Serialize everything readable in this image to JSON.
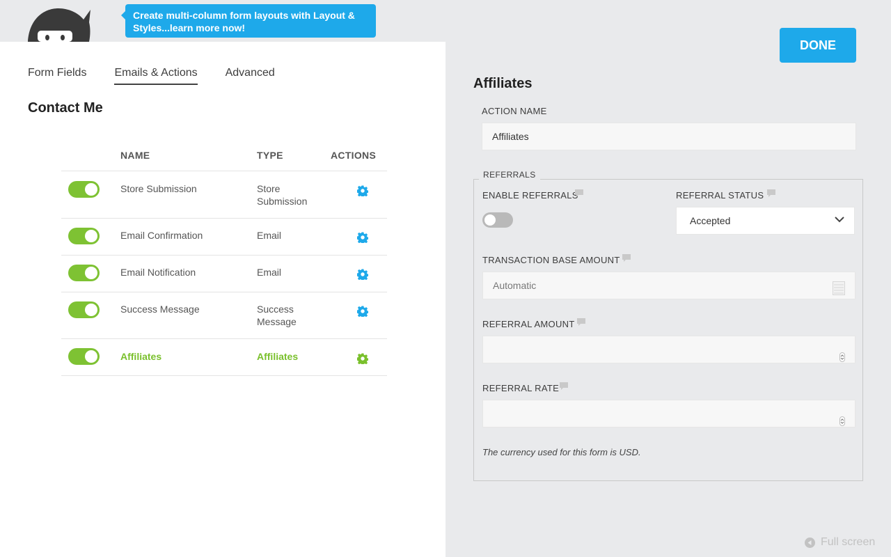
{
  "promo": {
    "text": "Create multi-column form layouts with Layout & Styles...learn more now!"
  },
  "tabs": [
    {
      "label": "Form Fields"
    },
    {
      "label": "Emails & Actions",
      "active": true
    },
    {
      "label": "Advanced"
    }
  ],
  "form_title": "Contact Me",
  "table": {
    "headers": {
      "name": "NAME",
      "type": "TYPE",
      "actions": "ACTIONS"
    },
    "rows": [
      {
        "enabled": true,
        "name": "Store Submission",
        "type": "Store Submission",
        "icon": "gear-icon"
      },
      {
        "enabled": true,
        "name": "Email Confirmation",
        "type": "Email",
        "icon": "gear-icon"
      },
      {
        "enabled": true,
        "name": "Email Notification",
        "type": "Email",
        "icon": "gear-icon"
      },
      {
        "enabled": true,
        "name": "Success Message",
        "type": "Success Message",
        "icon": "gear-icon"
      },
      {
        "enabled": true,
        "name": "Affiliates",
        "type": "Affiliates",
        "icon": "gear-icon",
        "highlighted": true
      }
    ]
  },
  "done_button": "DONE",
  "settings": {
    "title": "Affiliates",
    "action_name_label": "ACTION NAME",
    "action_name_value": "Affiliates",
    "referrals_legend": "REFERRALS",
    "enable_referrals_label": "ENABLE REFERRALS",
    "enable_referrals_on": false,
    "referral_status_label": "REFERRAL STATUS",
    "referral_status_value": "Accepted",
    "transaction_base_label": "TRANSACTION BASE AMOUNT",
    "transaction_base_value": "Automatic",
    "referral_amount_label": "REFERRAL AMOUNT",
    "referral_amount_value": "",
    "referral_rate_label": "REFERRAL RATE",
    "referral_rate_value": "",
    "currency_note": "The currency used for this form is USD."
  },
  "fullscreen_label": "Full screen",
  "colors": {
    "accent_blue": "#1ea9ea",
    "toggle_green": "#7ec233",
    "highlight_green": "#7ac02c",
    "toggle_off": "#b9b9b9"
  }
}
